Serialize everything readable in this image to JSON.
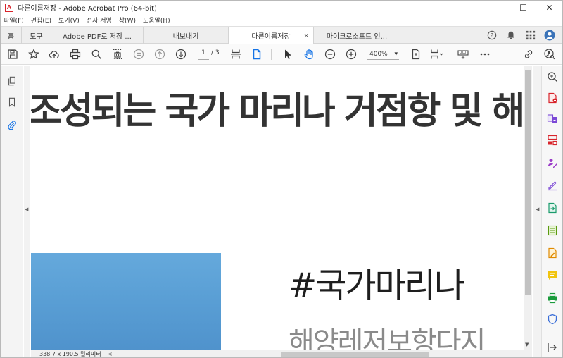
{
  "window": {
    "title": "다른이름저장 - Adobe Acrobat Pro (64-bit)",
    "app_icon_glyph": "A",
    "minimize_glyph": "—",
    "maximize_glyph": "☐",
    "close_glyph": "✕"
  },
  "menu": [
    "파일(F)",
    "편집(E)",
    "보기(V)",
    "전자 서명",
    "창(W)",
    "도움말(H)"
  ],
  "tabs": {
    "home": "홈",
    "tools": "도구",
    "doc_tabs": [
      {
        "label": "Adobe PDF로 저장 ..."
      },
      {
        "label": "내보내기"
      },
      {
        "label": "다른이름저장",
        "close": "×"
      },
      {
        "label": "마이크로소프트 인..."
      }
    ]
  },
  "toolbar": {
    "current_page": "1",
    "page_total": "/ 3",
    "zoom": "400%",
    "zoom_arrow": "▾"
  },
  "document": {
    "headline": "조성되는 국가 마리나 거점항 및 해",
    "hashtag": "#국가마리나",
    "hashtag2": "해양레저보항다지"
  },
  "statusbar": {
    "dimensions": "338.7 x 190.5 밀리미터",
    "scroll_left": "<"
  },
  "accent_colors": {
    "acrobat_red": "#d8242b",
    "active_blue": "#1473e6",
    "sea_blue": "#5a9fd5"
  }
}
